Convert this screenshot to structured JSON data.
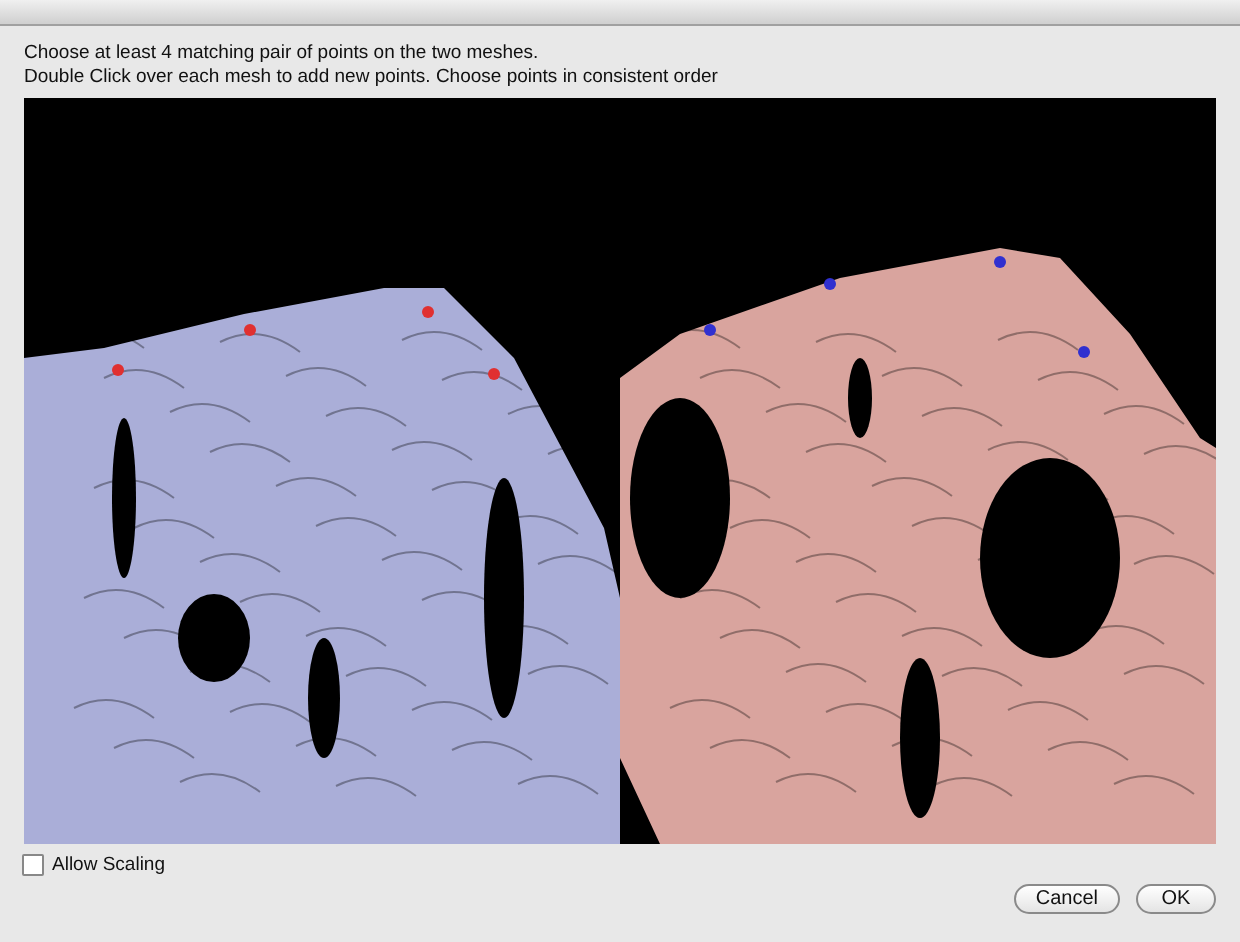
{
  "dialog": {
    "instructions": [
      "Choose at least 4 matching pair of points on the two meshes.",
      "Double Click over each mesh to add new points. Choose points in consistent order"
    ],
    "options": [
      {
        "label": "Allow Scaling",
        "checked": false
      }
    ],
    "buttons": [
      "Cancel",
      "OK"
    ]
  }
}
